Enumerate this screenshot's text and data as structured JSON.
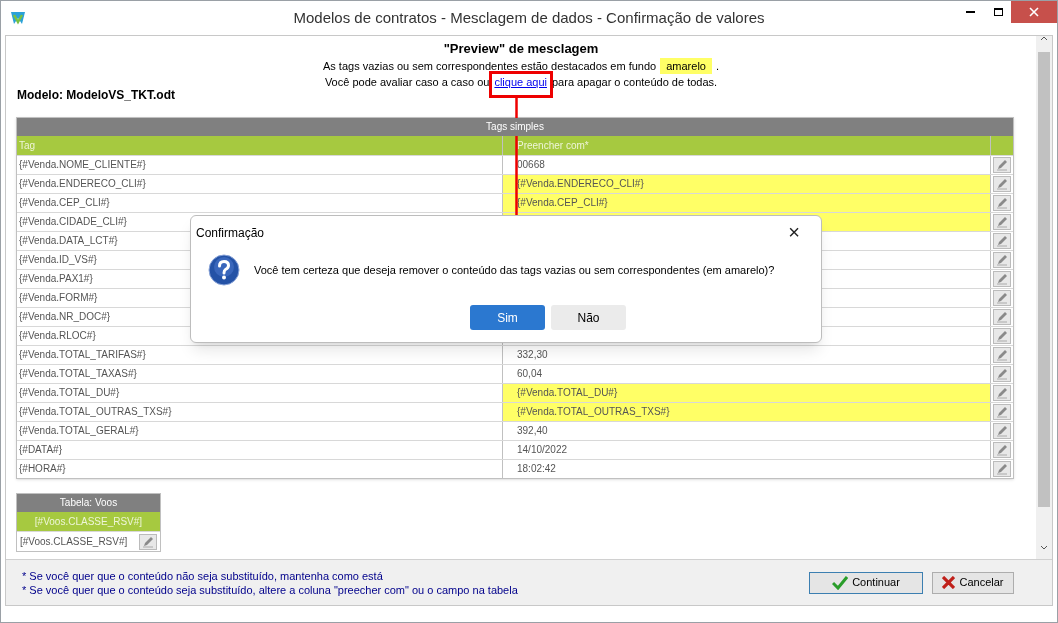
{
  "window": {
    "title": "Modelos de contratos - Mesclagem de dados - Confirmação de valores"
  },
  "preview": {
    "heading": "\"Preview\" de mesclagem",
    "line_1": "As tags vazias ou sem correspondentes estão destacados em fundo",
    "highlight_word": "amarelo",
    "line_1_end": ".",
    "line_2_start": "Você pode avaliar caso a caso ou",
    "link": "clique aqui",
    "line_2_end": "para apagar o conteúdo de todas."
  },
  "model": "Modelo: ModeloVS_TKT.odt",
  "table": {
    "title": "Tags simples",
    "columns": [
      "Tag",
      "Preencher com*"
    ],
    "rows": [
      {
        "tag": "{#Venda.NOME_CLIENTE#}",
        "value": "00668",
        "highlighted": false
      },
      {
        "tag": "{#Venda.ENDERECO_CLI#}",
        "value": "{#Venda.ENDERECO_CLI#}",
        "highlighted": true
      },
      {
        "tag": "{#Venda.CEP_CLI#}",
        "value": "{#Venda.CEP_CLI#}",
        "highlighted": true
      },
      {
        "tag": "{#Venda.CIDADE_CLI#}",
        "highlighted": true
      },
      {
        "tag": "{#Venda.DATA_LCT#}",
        "highlighted": false
      },
      {
        "tag": "{#Venda.ID_VS#}",
        "highlighted": false
      },
      {
        "tag": "{#Venda.PAX1#}",
        "highlighted": false
      },
      {
        "tag": "{#Venda.FORM#}",
        "highlighted": false
      },
      {
        "tag": "{#Venda.NR_DOC#}",
        "highlighted": false
      },
      {
        "tag": "{#Venda.RLOC#}",
        "highlighted": false
      },
      {
        "tag": "{#Venda.TOTAL_TARIFAS#}",
        "value": "332,30",
        "highlighted": false
      },
      {
        "tag": "{#Venda.TOTAL_TAXAS#}",
        "value": "60,04",
        "highlighted": false
      },
      {
        "tag": "{#Venda.TOTAL_DU#}",
        "value": "{#Venda.TOTAL_DU#}",
        "highlighted": true
      },
      {
        "tag": "{#Venda.TOTAL_OUTRAS_TXS#}",
        "value": "{#Venda.TOTAL_OUTRAS_TXS#}",
        "highlighted": true
      },
      {
        "tag": "{#Venda.TOTAL_GERAL#}",
        "value": "392,40",
        "highlighted": false
      },
      {
        "tag": "{#DATA#}",
        "value": "14/10/2022",
        "highlighted": false
      },
      {
        "tag": "{#HORA#}",
        "value": "18:02:42",
        "highlighted": false
      }
    ]
  },
  "voos_table": {
    "title": "Tabela: Voos",
    "column": "[#Voos.CLASSE_RSV#]",
    "rows": [
      "[#Voos.CLASSE_RSV#]"
    ]
  },
  "notes": [
    "* Se você quer que o conteúdo não seja substituído, mantenha como está",
    "* Se você quer que o conteúdo seja substituído, altere a coluna \"preecher com\" ou o campo na tabela"
  ],
  "buttons": [
    {
      "label": "Continuar",
      "kind": "ok"
    },
    {
      "label": "Cancelar",
      "kind": "cancel"
    }
  ],
  "dialog": {
    "title": "Confirmação",
    "close": "×",
    "message": "Você tem certeza que deseja remover o conteúdo das tags vazias ou sem correspondentes (em amarelo)?",
    "buttons": [
      {
        "label": "Sim",
        "primary": true
      },
      {
        "label": "Não",
        "primary": false
      }
    ]
  }
}
